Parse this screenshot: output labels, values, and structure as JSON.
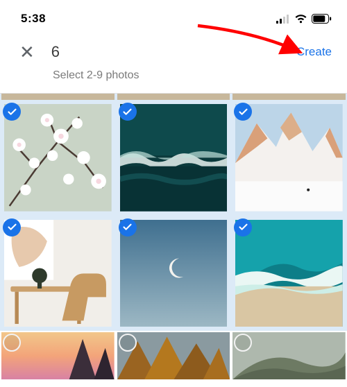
{
  "statusbar": {
    "time": "5:38"
  },
  "header": {
    "count": "6",
    "create_label": "Create",
    "subtitle": "Select 2-9 photos"
  },
  "grid": {
    "cells": [
      {
        "selected": true,
        "name": "cherry-blossoms"
      },
      {
        "selected": true,
        "name": "ocean-waves"
      },
      {
        "selected": true,
        "name": "snowy-mountain"
      },
      {
        "selected": true,
        "name": "desk-chair"
      },
      {
        "selected": true,
        "name": "moon-sky"
      },
      {
        "selected": true,
        "name": "beach-aerial"
      },
      {
        "selected": false,
        "name": "sunset-rocks"
      },
      {
        "selected": false,
        "name": "autumn-forest"
      },
      {
        "selected": false,
        "name": "misty-hill"
      }
    ]
  }
}
